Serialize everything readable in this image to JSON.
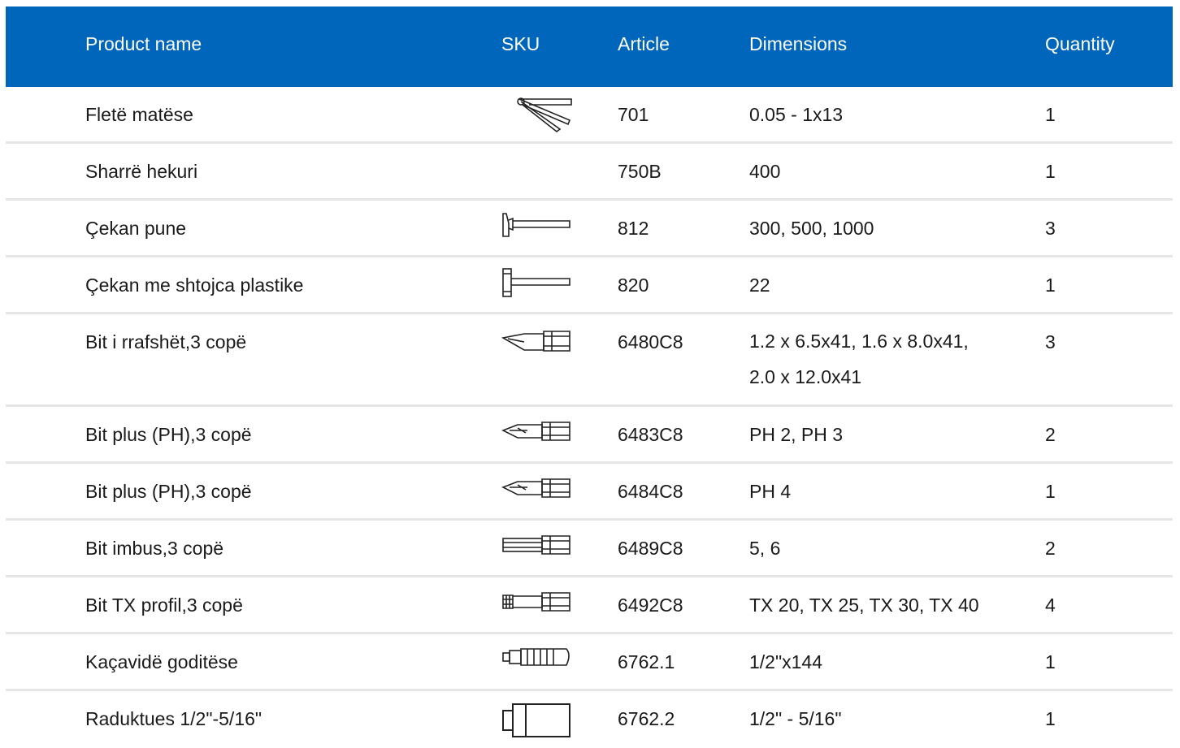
{
  "header": {
    "product_name": "Product name",
    "sku": "SKU",
    "article": "Article",
    "dimensions": "Dimensions",
    "quantity": "Quantity"
  },
  "rows": [
    {
      "name": "Fletë matëse",
      "icon": "feeler-gauge-icon",
      "article": "701",
      "dimensions": "0.05 - 1x13",
      "quantity": "1"
    },
    {
      "name": "Sharrë hekuri",
      "icon": "",
      "article": "750B",
      "dimensions": "400",
      "quantity": "1"
    },
    {
      "name": "Çekan pune",
      "icon": "hammer-icon",
      "article": "812",
      "dimensions": "300, 500, 1000",
      "quantity": "3"
    },
    {
      "name": "Çekan me shtojca plastike",
      "icon": "soft-face-hammer-icon",
      "article": "820",
      "dimensions": "22",
      "quantity": "1"
    },
    {
      "name": "Bit i rrafshët,3 copë",
      "icon": "flat-bit-icon",
      "article": "6480C8",
      "dimensions": "1.2 x 6.5x41, 1.6 x 8.0x41, 2.0 x 12.0x41",
      "quantity": "3"
    },
    {
      "name": "Bit plus (PH),3 copë",
      "icon": "phillips-bit-icon",
      "article": "6483C8",
      "dimensions": "PH 2, PH 3",
      "quantity": "2"
    },
    {
      "name": "Bit plus (PH),3 copë",
      "icon": "phillips-bit-icon",
      "article": "6484C8",
      "dimensions": "PH 4",
      "quantity": "1"
    },
    {
      "name": "Bit imbus,3 copë",
      "icon": "hex-bit-icon",
      "article": "6489C8",
      "dimensions": "5, 6",
      "quantity": "2"
    },
    {
      "name": "Bit TX profil,3 copë",
      "icon": "torx-bit-icon",
      "article": "6492C8",
      "dimensions": "TX 20, TX 25, TX 30, TX 40",
      "quantity": "4"
    },
    {
      "name": "Kaçavidë goditëse",
      "icon": "impact-driver-icon",
      "article": "6762.1",
      "dimensions": "1/2\"x144",
      "quantity": "1"
    },
    {
      "name": "Raduktues 1/2\"-5/16\"",
      "icon": "reducer-adapter-icon",
      "article": "6762.2",
      "dimensions": "1/2\" - 5/16\"",
      "quantity": "1"
    }
  ],
  "colors": {
    "header_bg": "#0066bb",
    "header_text": "#ffffff",
    "row_divider": "#e6e6e6"
  }
}
